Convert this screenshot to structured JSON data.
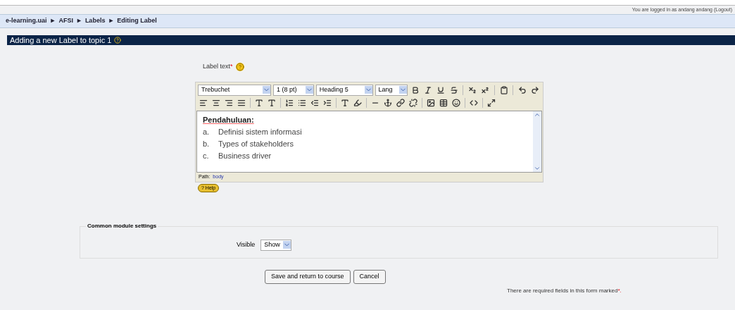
{
  "login_info": "You are logged in as andang  andang (Logout)",
  "breadcrumb": [
    "e-learning.uai",
    "AFSI",
    "Labels",
    "Editing Label"
  ],
  "breadcrumb_separator": "►",
  "heading": {
    "title": "Adding a new Label to topic 1"
  },
  "label_field": {
    "label": "Label text",
    "required_mark": "*"
  },
  "editor": {
    "selects": [
      {
        "value": "Trebuchet"
      },
      {
        "value": "1 (8 pt)"
      },
      {
        "value": "Heading 5"
      },
      {
        "value": "Lang"
      }
    ],
    "content_title": "Pendahuluan:",
    "list": [
      {
        "marker": "a.",
        "text": "Definisi sistem informasi"
      },
      {
        "marker": "b.",
        "text": "Types of stakeholders"
      },
      {
        "marker": "c.",
        "text": "Business driver"
      }
    ],
    "path_label": "Path:",
    "path_link": "body"
  },
  "help_button": "? Help",
  "fieldset": {
    "legend": "Common module settings",
    "field_label": "Visible",
    "select_value": "Show"
  },
  "buttons": [
    "Save and return to course",
    "Cancel"
  ],
  "footer_note": "There are required fields in this form marked",
  "footer_mark": "*."
}
